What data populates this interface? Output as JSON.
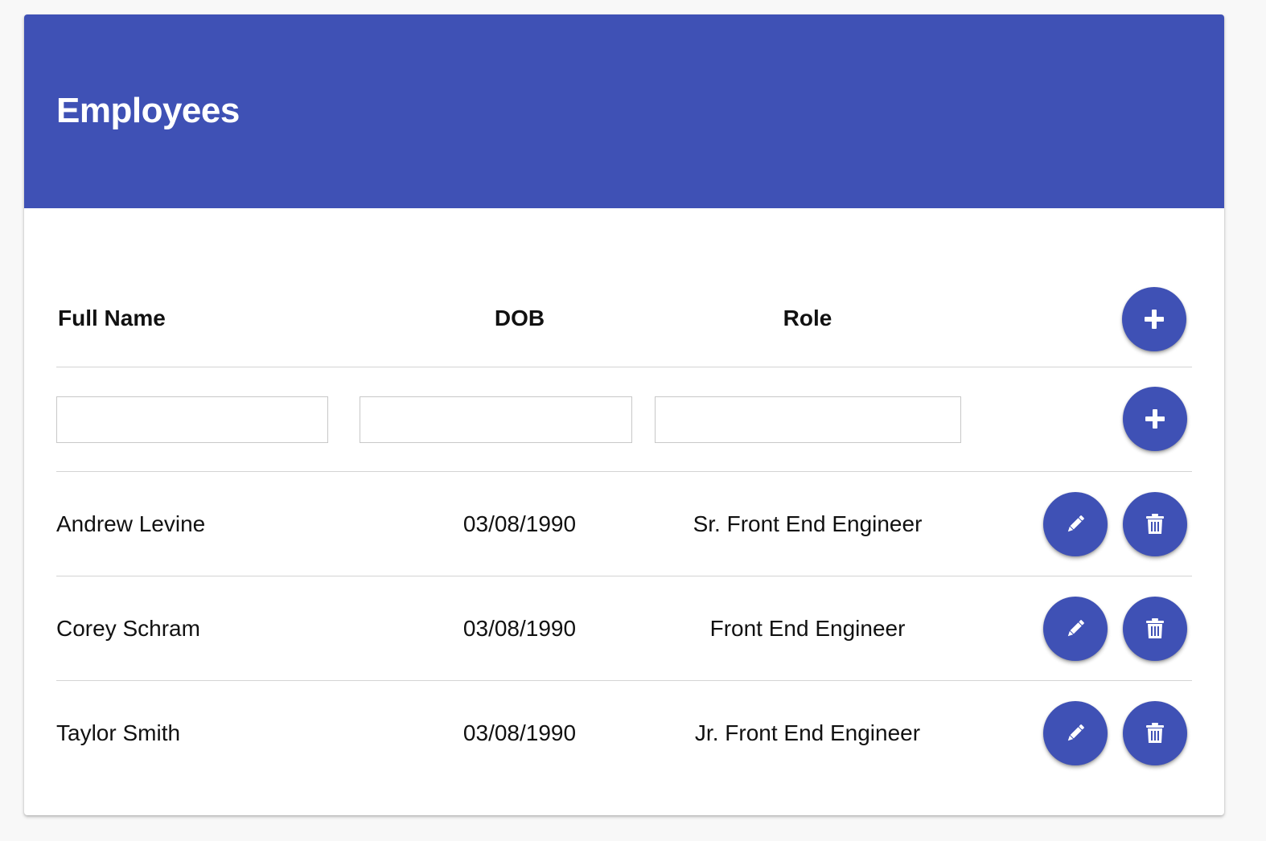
{
  "header": {
    "title": "Employees",
    "accent_color": "#3f51b5"
  },
  "table": {
    "columns": [
      "Full Name",
      "DOB",
      "Role"
    ],
    "add_button_icon": "plus-icon",
    "new_row": {
      "full_name": {
        "value": "",
        "placeholder": ""
      },
      "dob": {
        "value": "",
        "placeholder": ""
      },
      "role": {
        "value": "",
        "placeholder": ""
      },
      "add_button_icon": "plus-icon"
    },
    "rows": [
      {
        "full_name": "Andrew Levine",
        "dob": "03/08/1990",
        "role": "Sr. Front End Engineer",
        "edit_icon": "pencil-icon",
        "delete_icon": "trash-icon"
      },
      {
        "full_name": "Corey Schram",
        "dob": "03/08/1990",
        "role": "Front End Engineer",
        "edit_icon": "pencil-icon",
        "delete_icon": "trash-icon"
      },
      {
        "full_name": "Taylor Smith",
        "dob": "03/08/1990",
        "role": "Jr. Front End Engineer",
        "edit_icon": "pencil-icon",
        "delete_icon": "trash-icon"
      }
    ]
  }
}
